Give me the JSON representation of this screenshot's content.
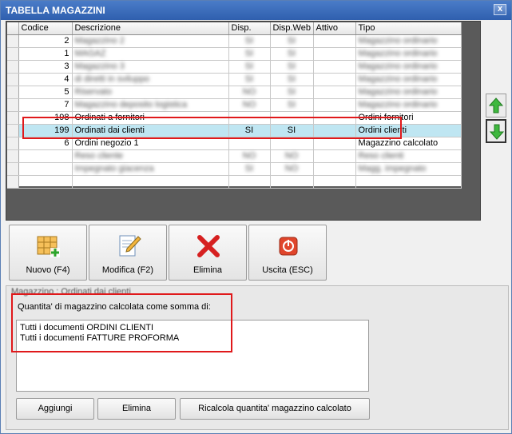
{
  "window": {
    "title": "TABELLA MAGAZZINI",
    "close_glyph": "x"
  },
  "grid": {
    "columns": [
      "Codice",
      "Descrizione",
      "Disp.",
      "Disp.Web",
      "Attivo",
      "Tipo"
    ],
    "rows": [
      {
        "codice": "2",
        "descrizione": "Magazzino 2",
        "disp": "SI",
        "dispweb": "SI",
        "attivo": "",
        "tipo": "Magazzino ordinario",
        "blurred": true
      },
      {
        "codice": "1",
        "descrizione": "MAGAZ",
        "disp": "SI",
        "dispweb": "SI",
        "attivo": "",
        "tipo": "Magazzino ordinario",
        "blurred": true
      },
      {
        "codice": "3",
        "descrizione": "Magazzino 3",
        "disp": "SI",
        "dispweb": "SI",
        "attivo": "",
        "tipo": "Magazzino ordinario",
        "blurred": true
      },
      {
        "codice": "4",
        "descrizione": "di diretti in sviluppo",
        "disp": "SI",
        "dispweb": "SI",
        "attivo": "",
        "tipo": "Magazzino ordinario",
        "blurred": true
      },
      {
        "codice": "5",
        "descrizione": "Riservato",
        "disp": "NO",
        "dispweb": "SI",
        "attivo": "",
        "tipo": "Magazzino ordinario",
        "blurred": true
      },
      {
        "codice": "7",
        "descrizione": "Magazzino deposito logistica",
        "disp": "NO",
        "dispweb": "SI",
        "attivo": "",
        "tipo": "Magazzino ordinario",
        "blurred": true
      },
      {
        "codice": "198",
        "descrizione": "Ordinati a fornitori",
        "disp": "",
        "dispweb": "",
        "attivo": "",
        "tipo": "Ordini fornitori",
        "blurred": false
      },
      {
        "codice": "199",
        "descrizione": "Ordinati dai clienti",
        "disp": "SI",
        "dispweb": "SI",
        "attivo": "",
        "tipo": "Ordini clienti",
        "blurred": false,
        "selected": true
      },
      {
        "codice": "6",
        "descrizione": "Ordini negozio 1",
        "disp": "",
        "dispweb": "",
        "attivo": "",
        "tipo": "Magazzino calcolato",
        "blurred": false
      },
      {
        "codice": "",
        "descrizione": "Reso cliente",
        "disp": "NO",
        "dispweb": "NO",
        "attivo": "",
        "tipo": "Reso clienti",
        "blurred": true
      },
      {
        "codice": "",
        "descrizione": "Impegnato giacenza",
        "disp": "SI",
        "dispweb": "NO",
        "attivo": "",
        "tipo": "Magg. impegnato",
        "blurred": true
      },
      {
        "codice": "",
        "descrizione": "",
        "disp": "",
        "dispweb": "",
        "attivo": "",
        "tipo": "",
        "blurred": false
      }
    ]
  },
  "side_buttons": {
    "up_icon": "arrow-up-icon",
    "down_icon": "arrow-down-icon"
  },
  "toolbar": {
    "new_label": "Nuovo (F4)",
    "edit_label": "Modifica (F2)",
    "delete_label": "Elimina",
    "exit_label": "Uscita (ESC)"
  },
  "detail": {
    "magazzino_title": "Magazzino : Ordinati dai clienti",
    "calc_label": "Quantita' di magazzino calcolata come somma di:",
    "memo_lines": [
      "Tutti i documenti ORDINI CLIENTI",
      "Tutti i documenti FATTURE PROFORMA"
    ],
    "add_label": "Aggiungi",
    "remove_label": "Elimina",
    "recalc_label": "Ricalcola quantita' magazzino calcolato"
  },
  "colors": {
    "highlight": "#e0191b",
    "selected_row": "#bfe6f2",
    "titlebar": "#3a6cbc"
  }
}
